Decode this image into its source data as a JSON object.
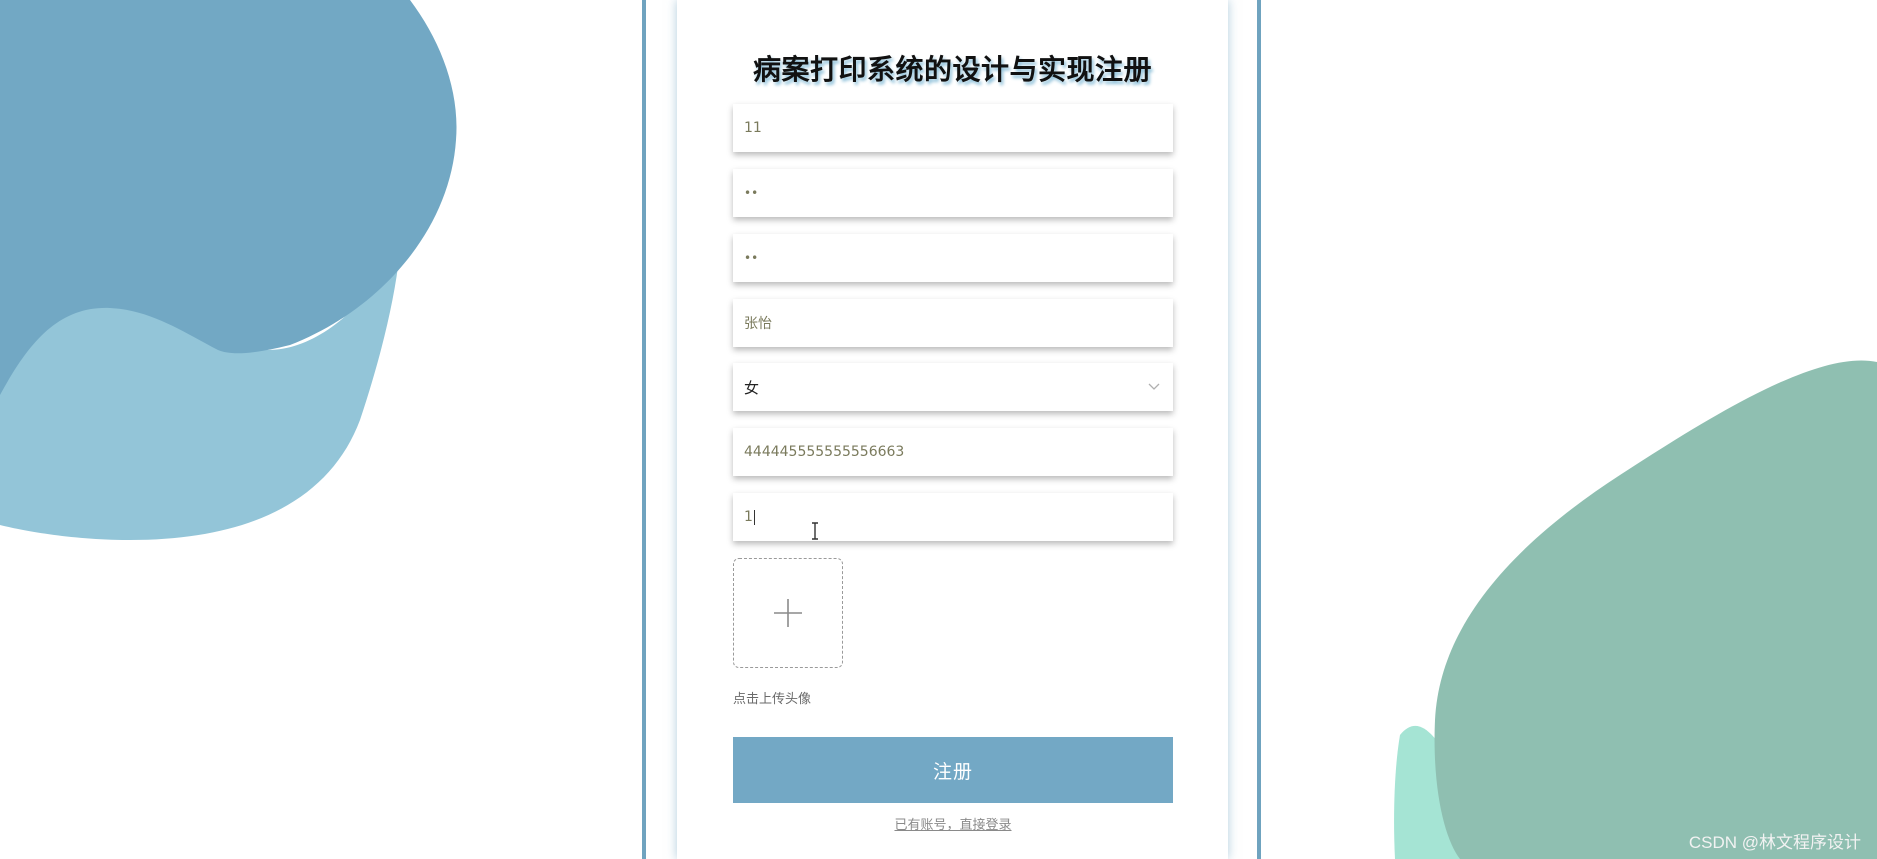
{
  "page": {
    "title": "病案打印系统的设计与实现注册"
  },
  "form": {
    "fields": [
      {
        "name": "account",
        "value": "11",
        "type": "text"
      },
      {
        "name": "password",
        "value": "••",
        "type": "password"
      },
      {
        "name": "confirm_password",
        "value": "••",
        "type": "password"
      },
      {
        "name": "name",
        "value": "张怡",
        "type": "text"
      },
      {
        "name": "gender",
        "value": "女",
        "type": "select"
      },
      {
        "name": "id_number",
        "value": "444445555555556663",
        "type": "text"
      },
      {
        "name": "phone",
        "value": "1",
        "type": "text"
      }
    ],
    "upload_tip": "点击上传头像",
    "submit_label": "注册",
    "login_link": "已有账号，直接登录"
  },
  "watermark": "CSDN @林文程序设计",
  "colors": {
    "primary": "#73a8c5",
    "frame": "#6fa3bf",
    "blob_blue_dark": "#72a8c4",
    "blob_blue_light": "#93c5d8",
    "blob_green": "#8fbfb1",
    "blob_mint": "#a5e4d4"
  },
  "icons": {
    "gender_dropdown": "chevron-down-icon",
    "uploader": "plus-icon",
    "mouse": "text-cursor-icon"
  }
}
